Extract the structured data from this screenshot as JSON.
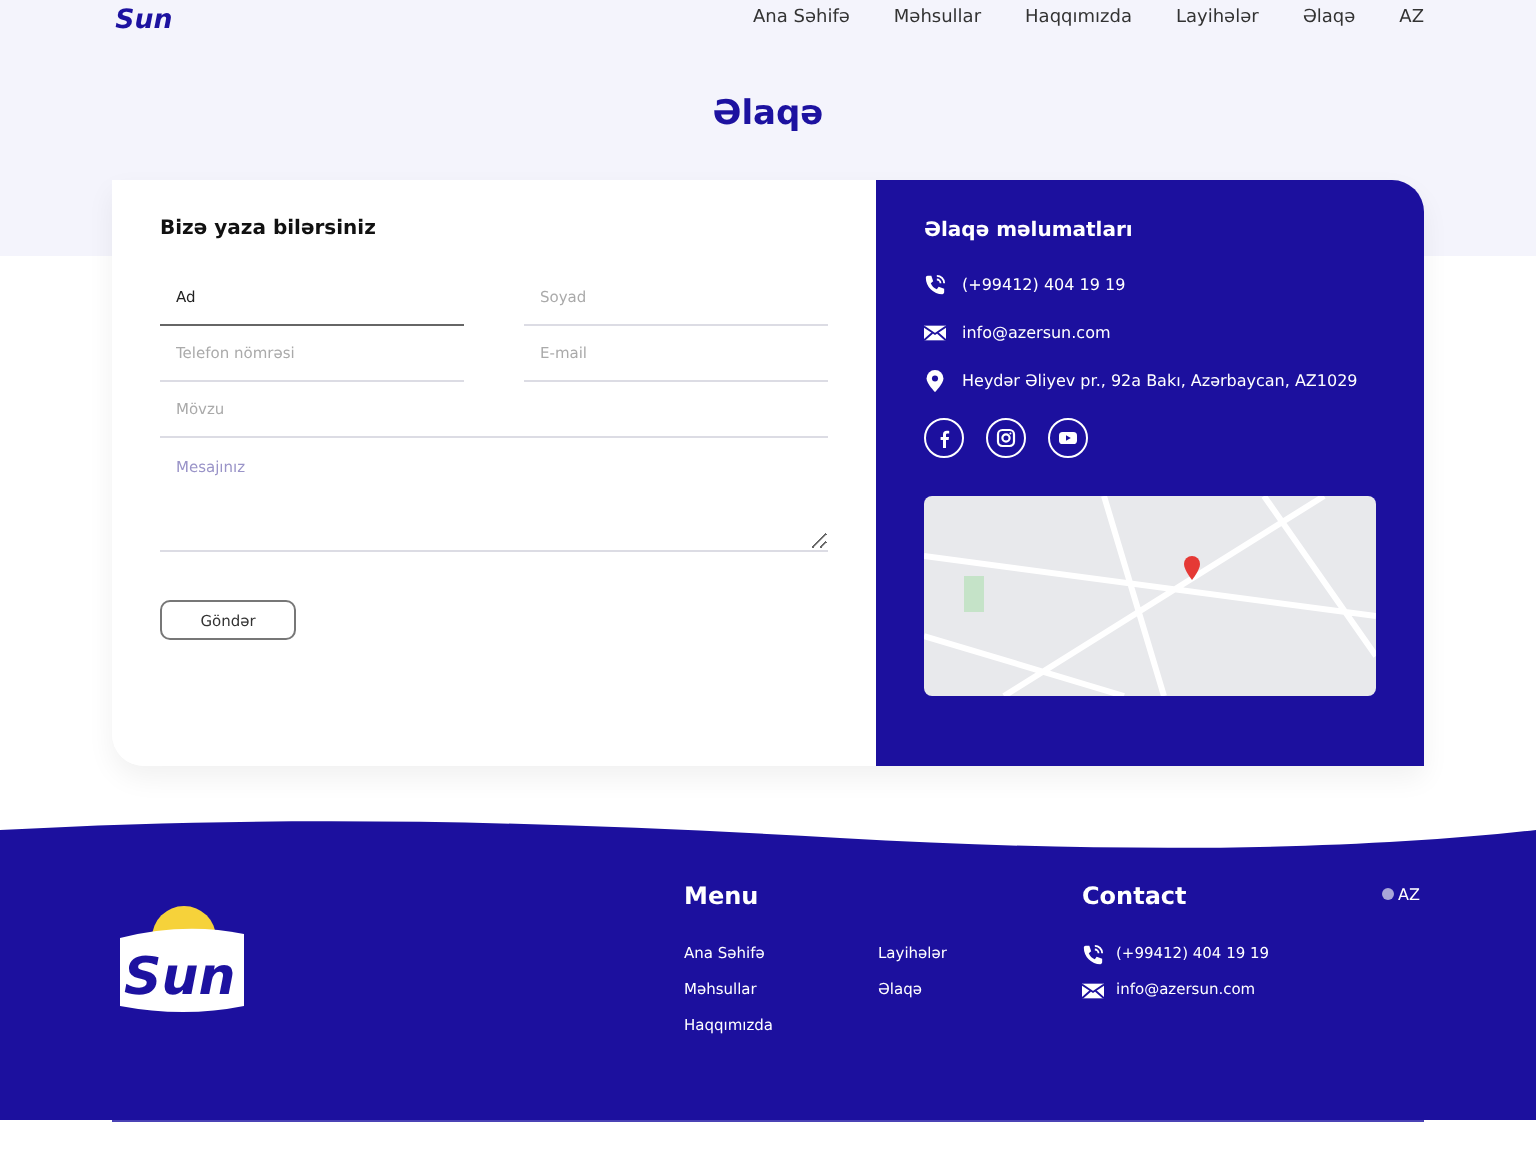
{
  "header": {
    "logo_text": "Sun",
    "nav": [
      {
        "label": "Ana Səhifə"
      },
      {
        "label": "Məhsullar"
      },
      {
        "label": "Haqqımızda"
      },
      {
        "label": "Layihələr"
      },
      {
        "label": "Əlaqə"
      }
    ],
    "language": "AZ"
  },
  "page_title": "Əlaqə",
  "form": {
    "title": "Bizə yaza bilərsiniz",
    "fields": [
      {
        "kind": "half",
        "placeholder": "Ad",
        "focused": true
      },
      {
        "kind": "half",
        "placeholder": "Soyad",
        "focused": false
      },
      {
        "kind": "half",
        "placeholder": "Telefon nömrəsi",
        "focused": false
      },
      {
        "kind": "half",
        "placeholder": "E-mail",
        "focused": false
      },
      {
        "kind": "full",
        "placeholder": "Mövzu",
        "focused": false
      },
      {
        "kind": "textarea",
        "placeholder": "Mesajınız",
        "focused": false
      }
    ],
    "submit": "Göndər"
  },
  "contact_info": {
    "title": "Əlaqə məlumatları",
    "items": [
      {
        "kind": "phone",
        "text": "(+99412) 404 19 19"
      },
      {
        "kind": "email",
        "text": "info@azersun.com"
      },
      {
        "kind": "location",
        "text": "Heydər Əliyev pr., 92a Bakı, Azərbaycan, AZ1029"
      }
    ],
    "socials": [
      {
        "kind": "facebook"
      },
      {
        "kind": "instagram"
      },
      {
        "kind": "youtube"
      }
    ]
  },
  "footer": {
    "logo_text": "Sun",
    "menu_title": "Menu",
    "menu": [
      {
        "label": "Ana Səhifə"
      },
      {
        "label": "Layihələr"
      },
      {
        "label": "Məhsullar"
      },
      {
        "label": "Əlaqə"
      },
      {
        "label": "Haqqımızda"
      }
    ],
    "contact_title": "Contact",
    "contacts": [
      {
        "kind": "phone",
        "text": "(+99412) 404 19 19"
      },
      {
        "kind": "email",
        "text": "info@azersun.com"
      }
    ],
    "language": "AZ"
  }
}
